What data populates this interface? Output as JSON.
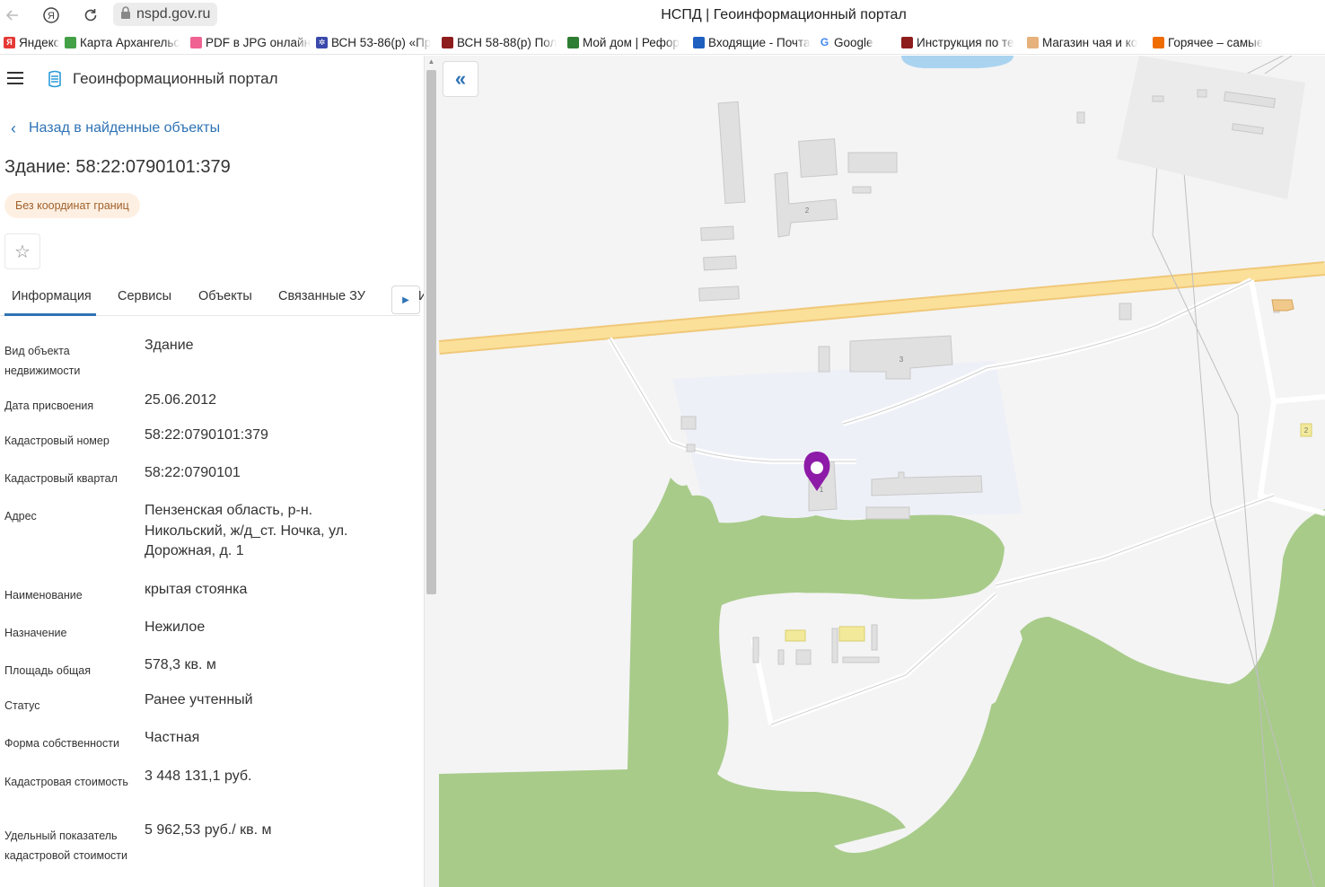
{
  "browser": {
    "url": "nspd.gov.ru",
    "tab_title": "НСПД | Геоинформационный портал"
  },
  "bookmarks": [
    {
      "label": "Яндекс",
      "color": "#e53935",
      "glyph": "Я"
    },
    {
      "label": "Карта Архангельс",
      "color": "#43a047",
      "glyph": ""
    },
    {
      "label": "PDF в JPG онлайн",
      "color": "#f06292",
      "glyph": ""
    },
    {
      "label": "ВСН 53-86(р) «Пр",
      "color": "#3949ab",
      "glyph": "✲"
    },
    {
      "label": "ВСН 58-88(р) Пол",
      "color": "#8d1c1c",
      "glyph": ""
    },
    {
      "label": "Мой дом | Рефор",
      "color": "#2e7d32",
      "glyph": ""
    },
    {
      "label": "Входящие - Почта",
      "color": "#1e5fbf",
      "glyph": ""
    },
    {
      "label": "Google",
      "color": "#ffffff",
      "glyph": "G"
    },
    {
      "label": "Инструкция по те",
      "color": "#8d1c1c",
      "glyph": ""
    },
    {
      "label": "Магазин чая и ко",
      "color": "#e6b17a",
      "glyph": ""
    },
    {
      "label": "Горячее – самые",
      "color": "#ef6c00",
      "glyph": ""
    }
  ],
  "app": {
    "title": "Геоинформационный портал",
    "back_label": "Назад в найденные объекты",
    "object_title": "Здание: 58:22:0790101:379",
    "badge": "Без координат границ",
    "tabs": [
      {
        "label": "Информация"
      },
      {
        "label": "Сервисы"
      },
      {
        "label": "Объекты"
      },
      {
        "label": "Связанные ЗУ"
      }
    ],
    "tab_cut_label": "И"
  },
  "info_rows": [
    {
      "label": "Вид объекта недвижимости",
      "value": "Здание"
    },
    {
      "label": "Дата присвоения",
      "value": "25.06.2012"
    },
    {
      "label": "Кадастровый номер",
      "value": "58:22:0790101:379"
    },
    {
      "label": "Кадастровый квартал",
      "value": "58:22:0790101"
    },
    {
      "label": "Адрес",
      "value": "Пензенская область, р-н. Никольский, ж/д_ст. Ночка, ул. Дорожная, д. 1"
    },
    {
      "label": "Наименование",
      "value": "крытая стоянка"
    },
    {
      "label": "Назначение",
      "value": "Нежилое"
    },
    {
      "label": "Площадь общая",
      "value": "578,3 кв. м"
    },
    {
      "label": "Статус",
      "value": "Ранее учтенный"
    },
    {
      "label": "Форма собственности",
      "value": "Частная"
    },
    {
      "label": "Кадастровая стоимость",
      "value": "3 448 131,1 руб."
    },
    {
      "label": "Удельный показатель кадастровой стоимости",
      "value": "5 962,53 руб./ кв. м"
    }
  ],
  "map": {
    "building_labels": [
      "2",
      "3",
      "1",
      "2"
    ],
    "marker_color": "#8e1aa8",
    "forest_color": "#a8cb8a",
    "road_color": "#fbe09a",
    "water_color": "#aad3f0"
  }
}
